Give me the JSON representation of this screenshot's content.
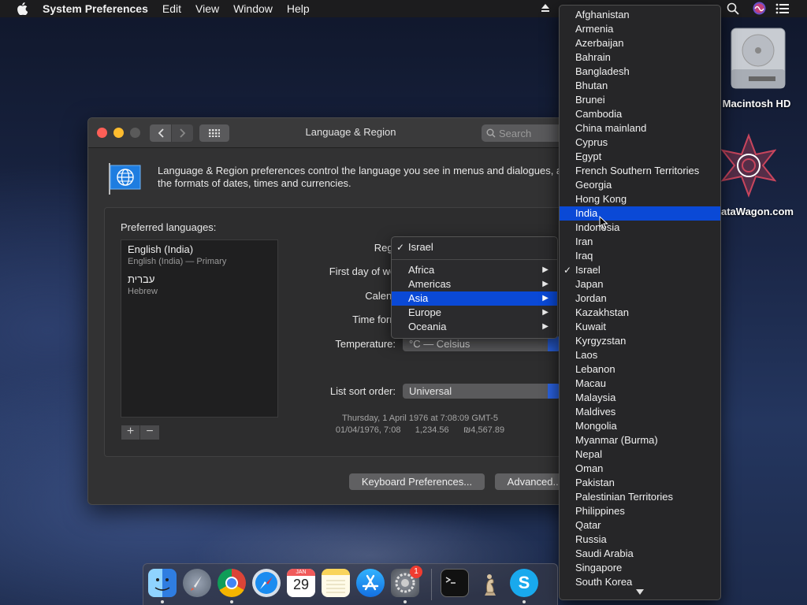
{
  "menubar": {
    "app_name": "System Preferences",
    "items": [
      "Edit",
      "View",
      "Window",
      "Help"
    ]
  },
  "desktop": {
    "hd_label": "Macintosh HD",
    "datawagon_label": "ataWagon.com"
  },
  "window": {
    "title": "Language & Region",
    "search_placeholder": "Search",
    "description": "Language & Region preferences control the language you see in menus and dialogues, and the formats of dates, times and currencies.",
    "preferred_label": "Preferred languages:",
    "languages": [
      {
        "name": "English (India)",
        "sub": "English (India) — Primary"
      },
      {
        "name": "עברית",
        "sub": "Hebrew"
      }
    ],
    "add_label": "+",
    "remove_label": "−",
    "fields": {
      "region": "Region",
      "first_day": "First day of week",
      "calendar": "Calendar",
      "time_format": "Time format",
      "temperature": "Temperature:",
      "list_sort": "List sort order:"
    },
    "temperature_value": "°C — Celsius",
    "list_sort_value": "Universal",
    "sample_line1": "Thursday, 1 April 1976 at 7:08:09 GMT-5",
    "sample_line2": "01/04/1976, 7:08      1,234.56      ₪4,567.89",
    "keyboard_btn": "Keyboard Preferences...",
    "advanced_btn": "Advanced..."
  },
  "region_menu": {
    "current": "Israel",
    "items": [
      {
        "label": "Africa"
      },
      {
        "label": "Americas"
      },
      {
        "label": "Asia",
        "selected": true
      },
      {
        "label": "Europe"
      },
      {
        "label": "Oceania"
      }
    ]
  },
  "country_menu": {
    "selected": "India",
    "checked": "Israel",
    "items": [
      "Afghanistan",
      "Armenia",
      "Azerbaijan",
      "Bahrain",
      "Bangladesh",
      "Bhutan",
      "Brunei",
      "Cambodia",
      "China mainland",
      "Cyprus",
      "Egypt",
      "French Southern Territories",
      "Georgia",
      "Hong Kong",
      "India",
      "Indonesia",
      "Iran",
      "Iraq",
      "Israel",
      "Japan",
      "Jordan",
      "Kazakhstan",
      "Kuwait",
      "Kyrgyzstan",
      "Laos",
      "Lebanon",
      "Macau",
      "Malaysia",
      "Maldives",
      "Mongolia",
      "Myanmar (Burma)",
      "Nepal",
      "Oman",
      "Pakistan",
      "Palestinian Territories",
      "Philippines",
      "Qatar",
      "Russia",
      "Saudi Arabia",
      "Singapore",
      "South Korea"
    ]
  },
  "dock": {
    "calendar_month": "JAN",
    "calendar_day": "29",
    "prefs_badge": "1",
    "apps": [
      "finder",
      "launchpad",
      "chrome",
      "safari",
      "calendar",
      "notes",
      "app-store",
      "system-preferences",
      "terminal",
      "chess",
      "skype"
    ]
  },
  "colors": {
    "accent": "#0a49d6",
    "window_bg": "#323233",
    "menu_bg": "#262628"
  }
}
